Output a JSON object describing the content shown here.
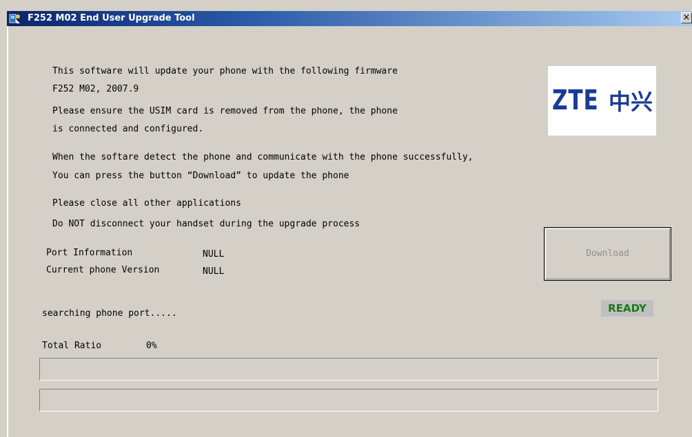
{
  "window": {
    "title": "F252 M02 End User Upgrade Tool",
    "close_label": "×"
  },
  "info": {
    "line1": "This software will update your phone with the following firmware",
    "line2": "F252 M02, 2007.9",
    "line3": "Please ensure the USIM card is removed from the phone, the phone",
    "line4": "is connected and configured.",
    "line5": "When the softare detect the phone and communicate with the phone successfully,",
    "line6": "You can press the button “Download” to update the phone",
    "line7": "Please close all other applications",
    "line8": "Do NOT disconnect your handset during the upgrade process"
  },
  "logo": {
    "brand": "ZTE",
    "chinese": "中兴"
  },
  "port": {
    "label": "Port Information",
    "value": "NULL"
  },
  "version": {
    "label": "Current phone Version",
    "value": "NULL"
  },
  "download_button": {
    "label": "Download",
    "enabled": false
  },
  "status": {
    "message": "searching phone port.....",
    "badge": "READY",
    "badge_color": "#1b7a1b"
  },
  "progress": {
    "label": "Total Ratio",
    "percent_text": "0%",
    "total_fraction": 0,
    "secondary_fraction": 0
  },
  "colors": {
    "titlebar_start": "#0a246a",
    "window_bg": "#d4d0c8",
    "logo_blue": "#1a3a96"
  }
}
